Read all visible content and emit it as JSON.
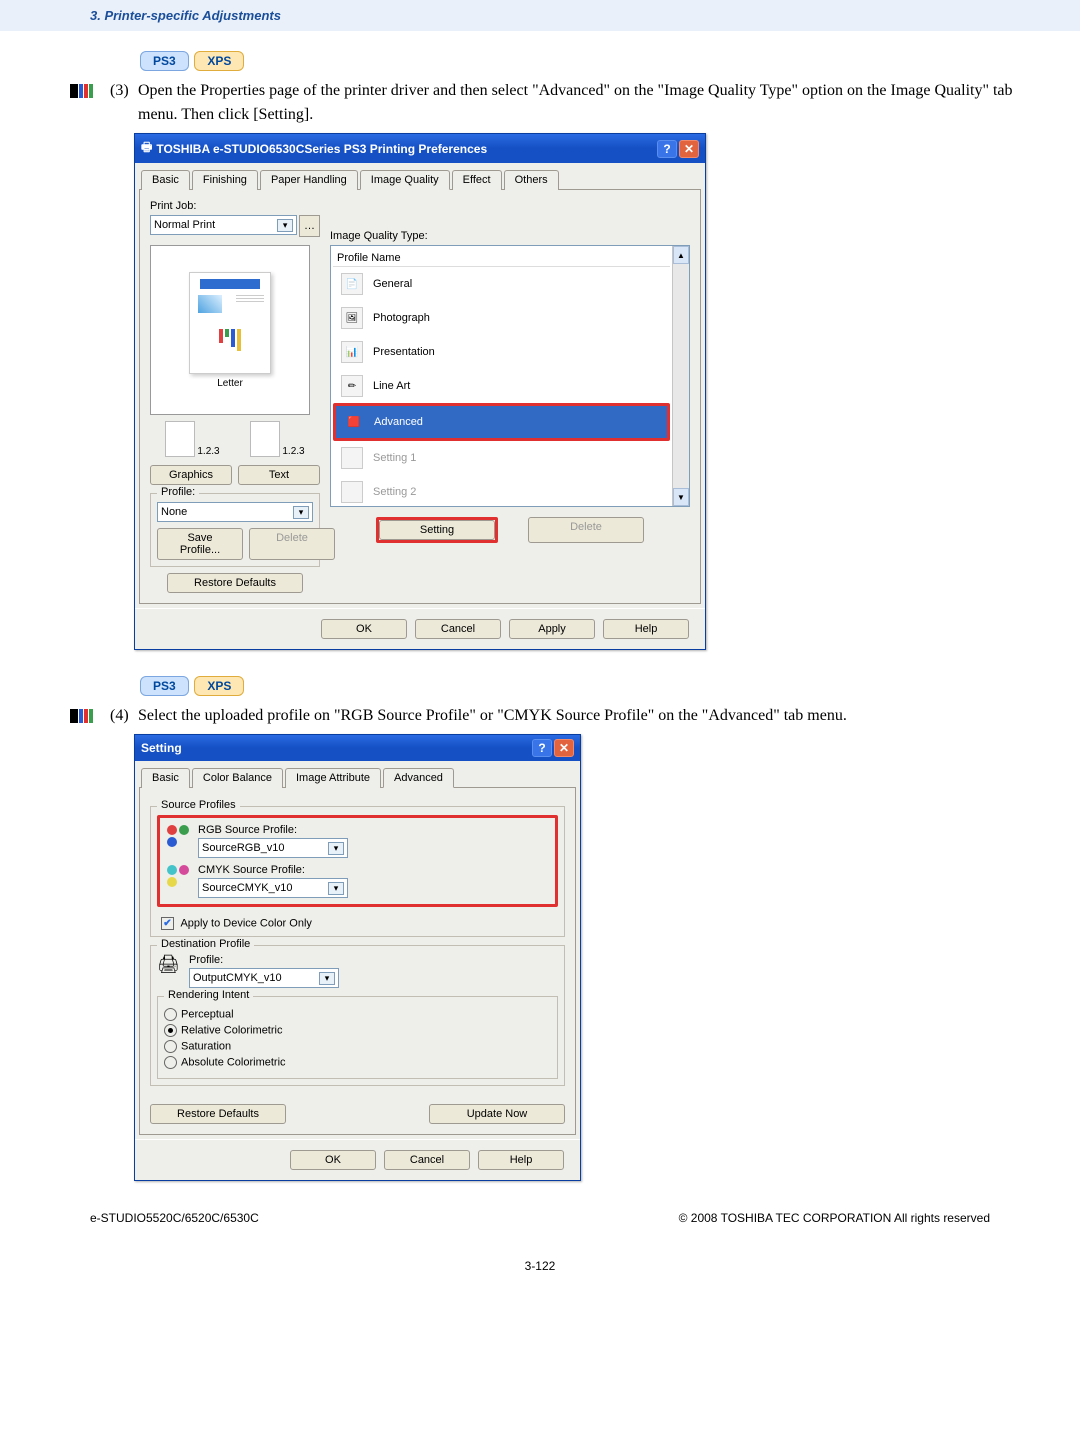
{
  "header_section_title": "3. Printer-specific Adjustments",
  "badges": {
    "ps3": "PS3",
    "xps": "XPS"
  },
  "step3_num": "(3)",
  "step3_text": "Open the Properties page of the printer driver and then select \"Advanced\" on the \"Image Quality Type\" option on the Image Quality\" tab menu. Then click [Setting].",
  "step4_num": "(4)",
  "step4_text": "Select the uploaded profile on \"RGB Source Profile\" or \"CMYK Source Profile\" on the \"Advanced\" tab menu.",
  "footer_model": "e-STUDIO5520C/6520C/6530C",
  "footer_copy": "© 2008 TOSHIBA TEC CORPORATION All rights reserved",
  "page_number": "3-122",
  "dlg1": {
    "title": "TOSHIBA e-STUDIO6530CSeries PS3 Printing Preferences",
    "tabs": [
      "Basic",
      "Finishing",
      "Paper Handling",
      "Image Quality",
      "Effect",
      "Others"
    ],
    "active_tab": 3,
    "print_job_label": "Print Job:",
    "print_job_value": "Normal Print",
    "paper_label": "Letter",
    "graphics": "Graphics",
    "text": "Text",
    "profile_label": "Profile:",
    "profile_value": "None",
    "save_profile": "Save Profile...",
    "delete": "Delete",
    "restore": "Restore Defaults",
    "image_quality_type_label": "Image Quality Type:",
    "profile_name_label": "Profile Name",
    "list": {
      "general": "General",
      "photograph": "Photograph",
      "presentation": "Presentation",
      "lineart": "Line Art",
      "advanced": "Advanced",
      "setting1": "Setting 1",
      "setting2": "Setting 2"
    },
    "setting_btn": "Setting",
    "delete2_btn": "Delete",
    "ok": "OK",
    "cancel": "Cancel",
    "apply": "Apply",
    "help": "Help",
    "thumb1": "1.2.3",
    "thumb2": "1.2.3"
  },
  "dlg2": {
    "title": "Setting",
    "tabs": [
      "Basic",
      "Color Balance",
      "Image Attribute",
      "Advanced"
    ],
    "active_tab": 3,
    "source_profiles": "Source Profiles",
    "rgb_label": "RGB Source Profile:",
    "rgb_value": "SourceRGB_v10",
    "cmyk_label": "CMYK Source Profile:",
    "cmyk_value": "SourceCMYK_v10",
    "apply_device": "Apply to Device Color Only",
    "dest_profile": "Destination Profile",
    "profile_label": "Profile:",
    "profile_value": "OutputCMYK_v10",
    "rendering": "Rendering Intent",
    "perceptual": "Perceptual",
    "relative": "Relative Colorimetric",
    "saturation": "Saturation",
    "absolute": "Absolute Colorimetric",
    "restore": "Restore Defaults",
    "update": "Update Now",
    "ok": "OK",
    "cancel": "Cancel",
    "help": "Help"
  }
}
